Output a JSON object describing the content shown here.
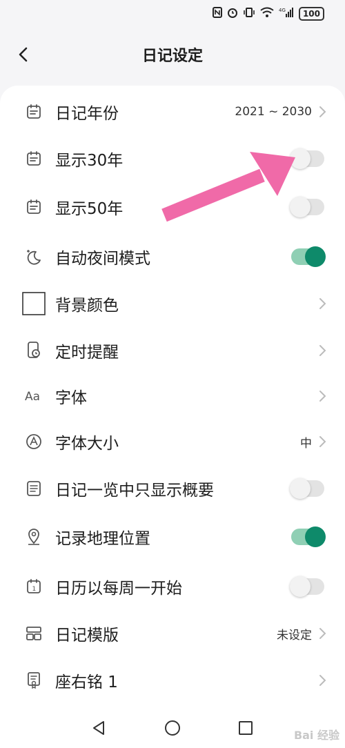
{
  "status_bar": {
    "battery": "100"
  },
  "header": {
    "title": "日记设定"
  },
  "settings": [
    {
      "label": "日记年份",
      "value": "2021 ~ 2030"
    },
    {
      "label": "显示30年",
      "toggle": false
    },
    {
      "label": "显示50年",
      "toggle": false
    },
    {
      "label": "自动夜间模式",
      "toggle": true
    },
    {
      "label": "背景颜色"
    },
    {
      "label": "定时提醒"
    },
    {
      "label": "字体"
    },
    {
      "label": "字体大小",
      "value": "中"
    },
    {
      "label": "日记一览中只显示概要",
      "toggle": false
    },
    {
      "label": "记录地理位置",
      "toggle": true
    },
    {
      "label": "日历以每周一开始",
      "toggle": false
    },
    {
      "label": "日记模版",
      "value": "未设定"
    },
    {
      "label": "座右铭 1"
    }
  ],
  "icons": {
    "calendar": "calendar-icon",
    "moon": "moon-icon",
    "color": "color-square-icon",
    "alarm": "alarm-icon",
    "font": "font-icon",
    "font_size": "font-size-icon",
    "summary": "list-icon",
    "location": "location-icon",
    "week": "calendar-week-icon",
    "template": "template-icon",
    "motto": "motto-icon"
  },
  "watermark": "Bai 经验",
  "colors": {
    "accent": "#0e8a6a",
    "annotation_arrow": "#f06aa8"
  }
}
